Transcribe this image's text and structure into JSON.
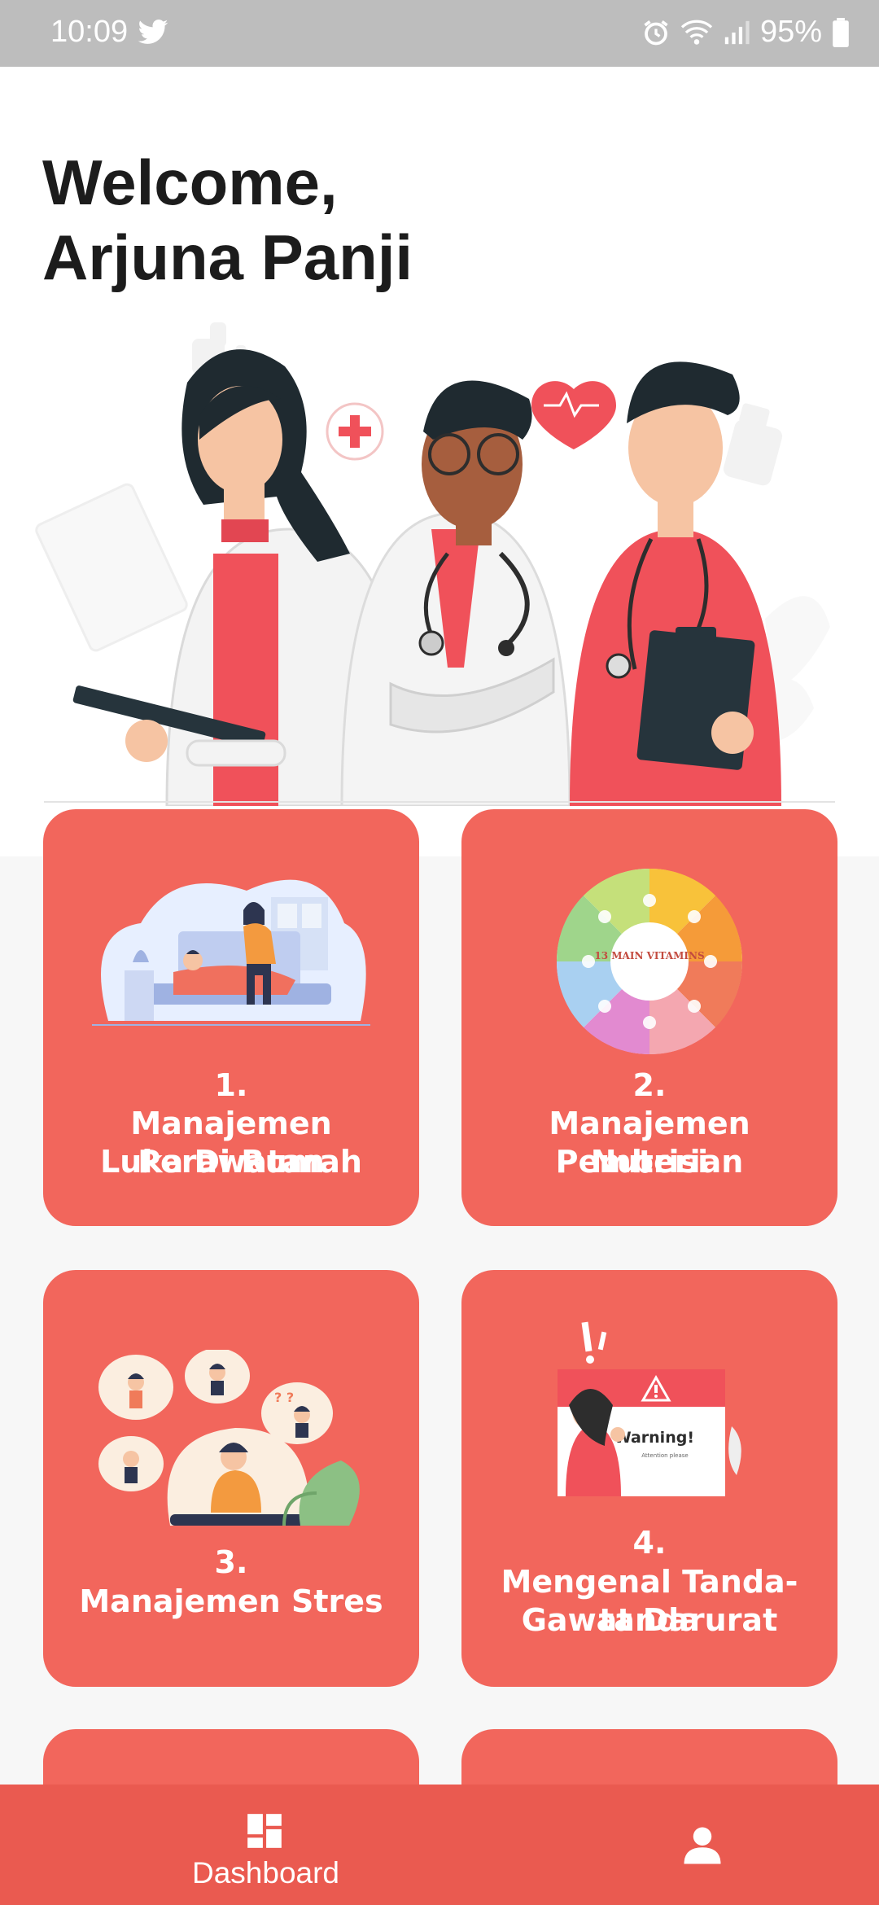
{
  "status_bar": {
    "time": "10:09",
    "battery": "95%",
    "icons": [
      "twitter-icon",
      "alarm-icon",
      "wifi-icon",
      "signal-icon",
      "battery-icon"
    ]
  },
  "header": {
    "line1": "Welcome,",
    "line2": "Arjuna Panji"
  },
  "menu": [
    {
      "number": "1.",
      "line1": "Manajemen Perawatan",
      "line2": "Luka Di Rumah"
    },
    {
      "number": "2.",
      "line1": "Manajemen Pemberian",
      "line2": "Nutrisi",
      "image_text": "13 MAIN VITAMINS"
    },
    {
      "number": "3.",
      "line1": "Manajemen Stres"
    },
    {
      "number": "4.",
      "line1": "Mengenal Tanda-tanda",
      "line2": "Gawat Darurat",
      "image_text": "Warning!",
      "image_subtext": "Attention please"
    }
  ],
  "bottom_nav": {
    "dashboard_label": "Dashboard",
    "profile_icon": "person-icon"
  },
  "colors": {
    "card": "#f2665c",
    "nav": "#ea5a50",
    "status_bar": "#bdbdbd",
    "accent_red": "#f0515a"
  }
}
